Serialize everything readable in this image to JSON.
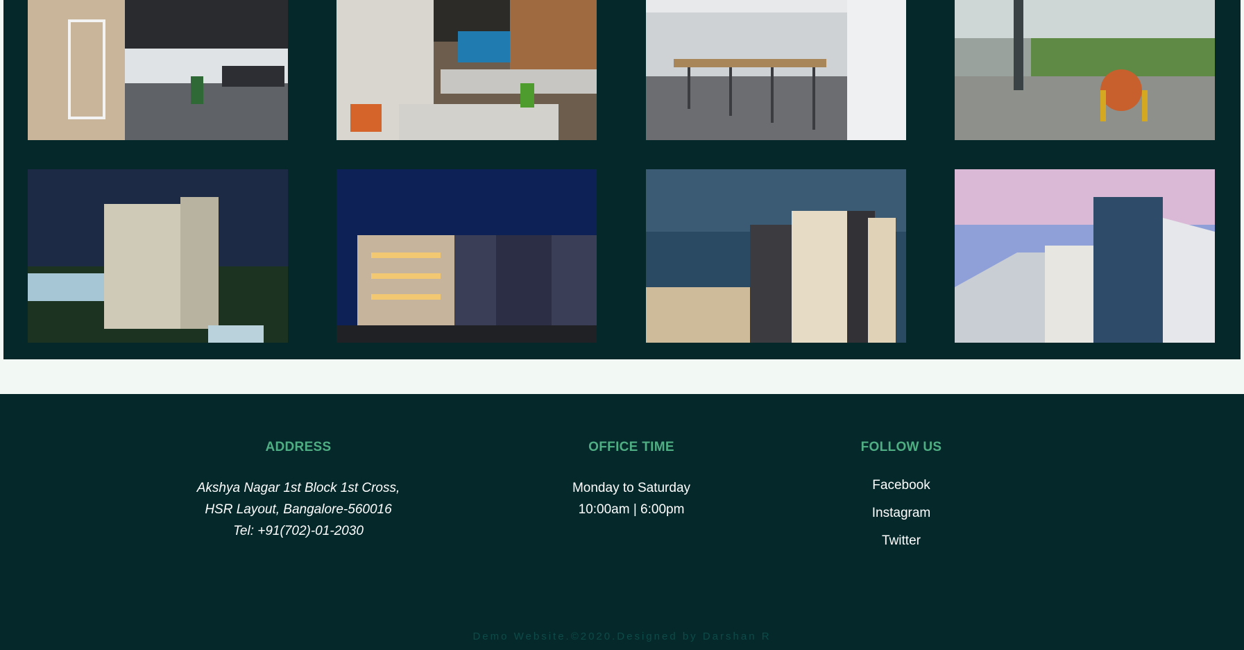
{
  "gallery": {
    "background": "#05292a",
    "photos": [
      {
        "name": "office-interior-photo-1",
        "alt": "Office interior with glass partitions"
      },
      {
        "name": "office-cafeteria-photo",
        "alt": "Cafeteria with mural and colourful chairs"
      },
      {
        "name": "office-bar-counter-photo",
        "alt": "Bar counter with stools and pendant lights"
      },
      {
        "name": "office-terrace-photo",
        "alt": "Outdoor terrace seating with garden"
      },
      {
        "name": "apartment-tower-night-photo",
        "alt": "High-rise apartment tower at night"
      },
      {
        "name": "apartment-block-night-photo",
        "alt": "Lit apartment block at dusk"
      },
      {
        "name": "apartment-corner-dusk-photo",
        "alt": "Corner apartment building at dusk"
      },
      {
        "name": "apartment-glass-facade-photo",
        "alt": "Glass facade apartment against pink sky"
      }
    ]
  },
  "footer": {
    "address": {
      "title": "ADDRESS",
      "lines": [
        "Akshya Nagar 1st Block 1st Cross,",
        "HSR Layout, Bangalore-560016",
        "Tel: +91(702)-01-2030"
      ]
    },
    "office_time": {
      "title": "OFFICE TIME",
      "lines": [
        "Monday to Saturday",
        "10:00am | 6:00pm"
      ]
    },
    "follow_us": {
      "title": "FOLLOW US",
      "links": [
        "Facebook",
        "Instagram",
        "Twitter"
      ]
    },
    "copyright": "Demo Website.©2020.Designed by Darshan R"
  },
  "colors": {
    "dark_teal": "#05292a",
    "accent_green": "#4fae83",
    "page_bg": "#f2f8f4"
  }
}
